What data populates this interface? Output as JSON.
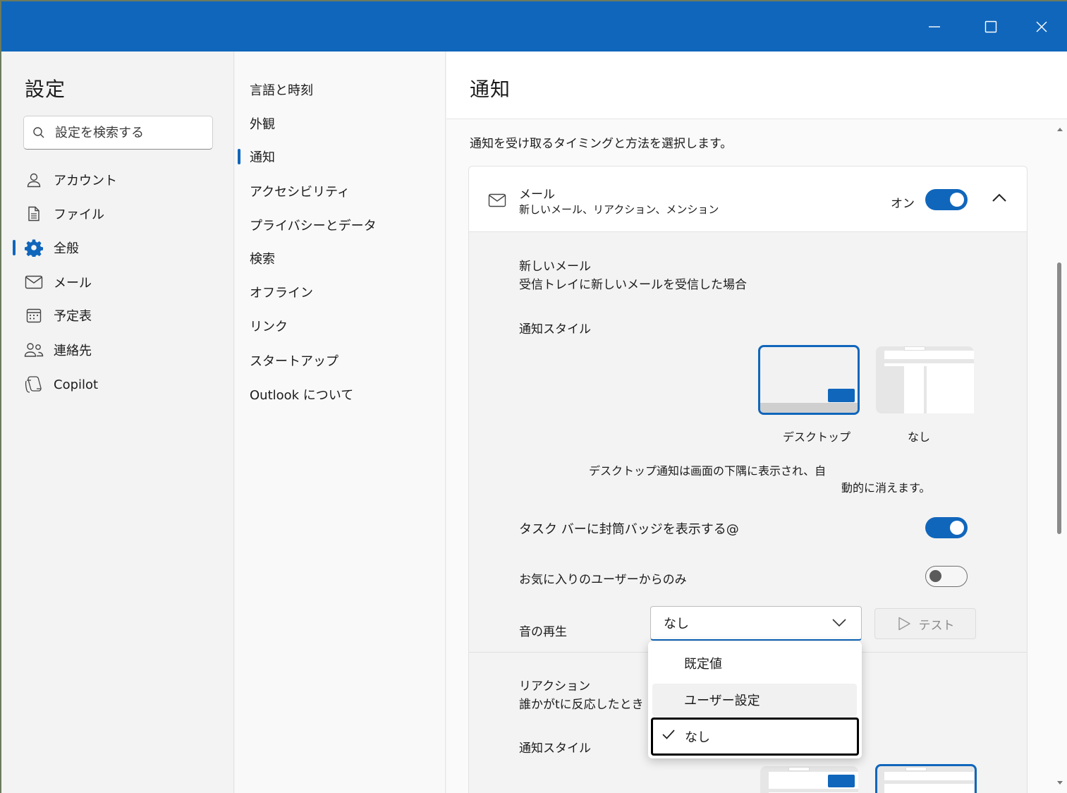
{
  "window": {
    "controls": {
      "minimize": "minimize-icon",
      "maximize": "maximize-icon",
      "close": "close-icon"
    },
    "accent": "#1066bb"
  },
  "nav": {
    "title": "設定",
    "search_placeholder": "設定を検索する",
    "items": [
      {
        "label": "アカウント",
        "icon": "person-icon"
      },
      {
        "label": "ファイル",
        "icon": "file-icon"
      },
      {
        "label": "全般",
        "icon": "gear-icon",
        "selected": true
      },
      {
        "label": "メール",
        "icon": "mail-icon"
      },
      {
        "label": "予定表",
        "icon": "calendar-icon"
      },
      {
        "label": "連絡先",
        "icon": "contacts-icon"
      },
      {
        "label": "Copilot",
        "icon": "copilot-icon"
      }
    ]
  },
  "sub_nav": {
    "items": [
      {
        "label": "言語と時刻"
      },
      {
        "label": "外観"
      },
      {
        "label": "通知",
        "selected": true
      },
      {
        "label": "アクセシビリティ"
      },
      {
        "label": "プライバシーとデータ"
      },
      {
        "label": "検索"
      },
      {
        "label": "オフライン"
      },
      {
        "label": "リンク"
      },
      {
        "label": "スタートアップ"
      },
      {
        "label": "Outlook について"
      }
    ]
  },
  "main": {
    "title": "通知",
    "description": "通知を受け取るタイミングと方法を選択します。",
    "mail_card": {
      "title": "メール",
      "subtitle": "新しいメール、リアクション、メンション",
      "state_label": "オン",
      "enabled": true,
      "new_mail": {
        "title": "新しいメール",
        "subtitle": "受信トレイに新しいメールを受信した場合",
        "style_label": "通知スタイル",
        "styles": [
          {
            "label": "デスクトップ",
            "selected": true
          },
          {
            "label": "なし",
            "selected": false
          }
        ],
        "help_line1": "デスクトップ通知は画面の下隅に表示され、自",
        "help_line2": "動的に消えます。",
        "taskbar_badge_label": "タスク バーに封筒バッジを表示する@",
        "taskbar_badge_on": true,
        "favorites_only_label": "お気に入りのユーザーからのみ",
        "favorites_only_on": false,
        "sound_label": "音の再生",
        "sound_value": "なし",
        "test_label": "テスト"
      },
      "reactions": {
        "title": "リアクション",
        "subtitle": "誰かがtに反応したとき",
        "style_label": "通知スタイル"
      }
    },
    "sound_menu": {
      "options": [
        {
          "label": "既定値"
        },
        {
          "label": "ユーザー設定",
          "hovered": true
        },
        {
          "label": "なし",
          "selected": true
        }
      ]
    }
  }
}
